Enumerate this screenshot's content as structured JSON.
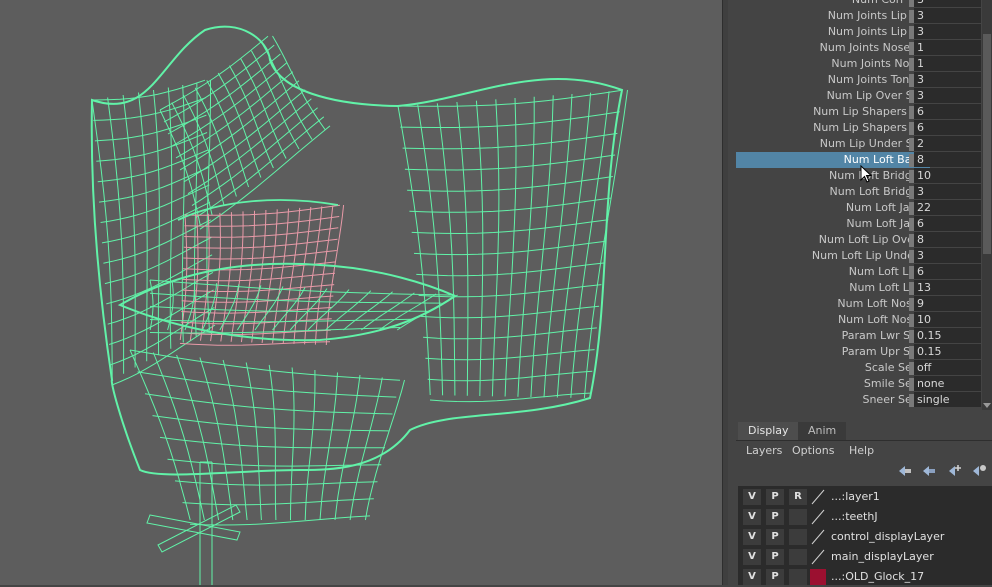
{
  "attributes": [
    {
      "label": "Num Corr Lips",
      "value": "3"
    },
    {
      "label": "Num Joints Lip Lwr",
      "value": "3"
    },
    {
      "label": "Num Joints Lip Upr",
      "value": "3"
    },
    {
      "label": "Num Joints Nose Tip",
      "value": "1"
    },
    {
      "label": "Num Joints Nostril",
      "value": "1"
    },
    {
      "label": "Num Joints Tongue",
      "value": "3"
    },
    {
      "label": "Num Lip Over Split",
      "value": "3"
    },
    {
      "label": "Num Lip Shapers Lwr",
      "value": "6"
    },
    {
      "label": "Num Lip Shapers Upr",
      "value": "6"
    },
    {
      "label": "Num Lip Under Split",
      "value": "2"
    },
    {
      "label": "Num Loft Bag U",
      "value": "8"
    },
    {
      "label": "Num Loft Bridge U",
      "value": "10"
    },
    {
      "label": "Num Loft Bridge V",
      "value": "3"
    },
    {
      "label": "Num Loft Jaw U",
      "value": "22"
    },
    {
      "label": "Num Loft Jaw V",
      "value": "6"
    },
    {
      "label": "Num Loft Lip Over U",
      "value": "8"
    },
    {
      "label": "Num Loft Lip Under U",
      "value": "3"
    },
    {
      "label": "Num Loft Lip U",
      "value": "6"
    },
    {
      "label": "Num Loft Lip V",
      "value": "13"
    },
    {
      "label": "Num Loft Nose U",
      "value": "9"
    },
    {
      "label": "Num Loft Nose V",
      "value": "10"
    },
    {
      "label": "Param Lwr Start",
      "value": "0.15"
    },
    {
      "label": "Param Upr Start",
      "value": "0.15"
    },
    {
      "label": "Scale Setup",
      "value": "off"
    },
    {
      "label": "Smile Setup",
      "value": "none"
    },
    {
      "label": "Sneer Setup",
      "value": "single"
    }
  ],
  "selected_attribute": "Num Loft Bag U",
  "layer_editor": {
    "tabs": [
      "Display",
      "Anim"
    ],
    "active_tab": "Display",
    "menu": [
      "Layers",
      "Options",
      "Help"
    ],
    "tools": [
      "move-layer-up-icon",
      "move-layer-down-icon",
      "new-layer-icon",
      "new-layer-from-selected-icon"
    ],
    "layers": [
      {
        "v": "V",
        "p": "P",
        "r": "R",
        "name": "...:layer1",
        "color": ""
      },
      {
        "v": "V",
        "p": "P",
        "r": "",
        "name": "...:teethJ",
        "color": ""
      },
      {
        "v": "V",
        "p": "P",
        "r": "",
        "name": "control_displayLayer",
        "color": ""
      },
      {
        "v": "V",
        "p": "P",
        "r": "",
        "name": "main_displayLayer",
        "color": ""
      },
      {
        "v": "V",
        "p": "P",
        "r": "",
        "name": "...:OLD_Glock_17",
        "color": "#9b1030"
      }
    ]
  },
  "colors": {
    "viewport_bg": "#5d5d5d",
    "wireframe": "#61f2a8",
    "wireframe_inner": "#e89aa8",
    "selection": "#5285a6"
  }
}
